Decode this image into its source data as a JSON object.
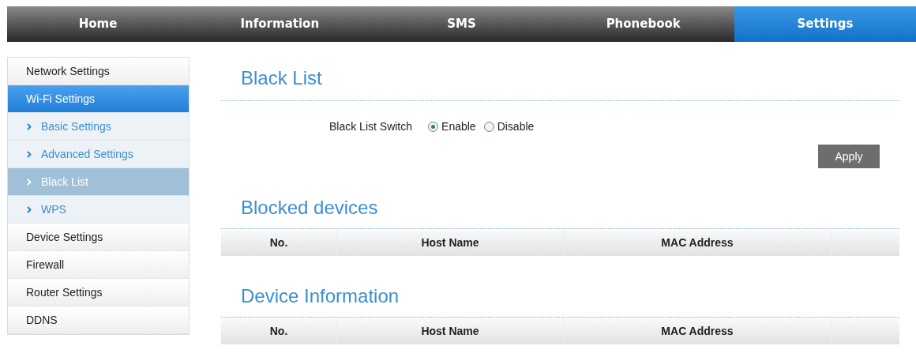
{
  "nav_tabs": [
    {
      "label": "Home",
      "selected": false
    },
    {
      "label": "Information",
      "selected": false
    },
    {
      "label": "SMS",
      "selected": false
    },
    {
      "label": "Phonebook",
      "selected": false
    },
    {
      "label": "Settings",
      "selected": true
    }
  ],
  "sidebar": {
    "items": [
      {
        "label": "Network Settings",
        "selected": false
      },
      {
        "label": "Wi-Fi Settings",
        "selected": true,
        "children": [
          {
            "label": "Basic Settings",
            "selected": false
          },
          {
            "label": "Advanced Settings",
            "selected": false
          },
          {
            "label": "Black List",
            "selected": true
          },
          {
            "label": "WPS",
            "selected": false
          }
        ]
      },
      {
        "label": "Device Settings",
        "selected": false
      },
      {
        "label": "Firewall",
        "selected": false
      },
      {
        "label": "Router Settings",
        "selected": false
      },
      {
        "label": "DDNS",
        "selected": false
      }
    ]
  },
  "title": "Black List",
  "switch": {
    "label": "Black List Switch",
    "options": [
      {
        "label": "Enable",
        "selected": true
      },
      {
        "label": "Disable",
        "selected": false
      }
    ]
  },
  "apply_button": "Apply",
  "tables": [
    {
      "title": "Blocked devices",
      "columns": [
        "No.",
        "Host Name",
        "MAC Address",
        ""
      ]
    },
    {
      "title": "Device Information",
      "columns": [
        "No.",
        "Host Name",
        "MAC Address",
        ""
      ]
    }
  ]
}
